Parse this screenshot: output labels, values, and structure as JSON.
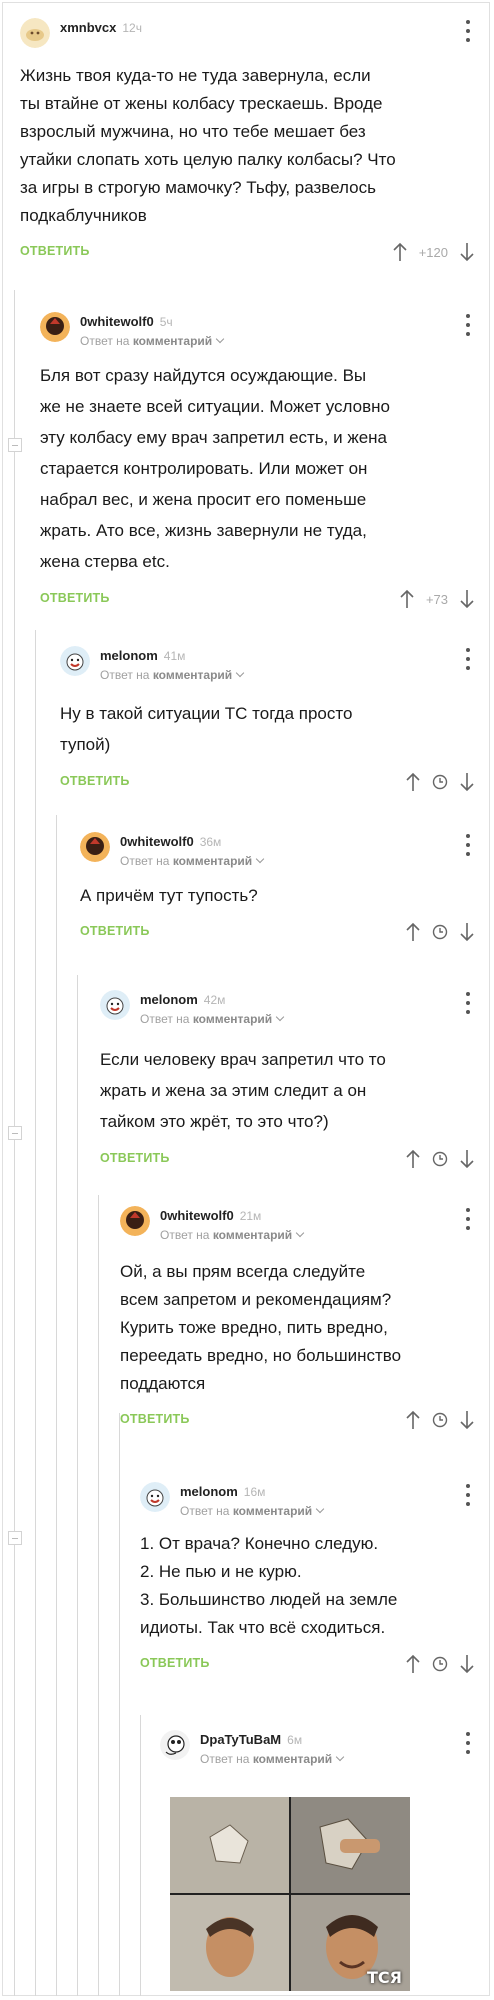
{
  "reply_label": "ОТВЕТИТЬ",
  "reply_to_prefix": "Ответ на",
  "reply_to_target": "комментарий",
  "comments": [
    {
      "user": "xmnbvcx",
      "time": "12ч",
      "text": [
        "Жизнь твоя куда-то не туда завернула, если",
        "ты втайне от жены колбасу трескаешь. Вроде",
        "взрослый мужчина, но что тебе мешает без",
        "утайки слопать хоть целую палку колбасы? Что",
        "за игры в строгую мамочку? Тьфу, развелось",
        "подкаблучников"
      ],
      "rating": "+120"
    },
    {
      "user": "0whitewolf0",
      "time": "5ч",
      "text": [
        "Бля вот сразу найдутся осуждающие. Вы",
        "же не знаете всей ситуации. Может условно",
        "эту колбасу ему врач запретил есть, и жена",
        "старается контролировать. Или может он",
        "набрал вес, и жена просит его поменьше",
        "жрать. Ато все, жизнь завернули не туда,",
        "жена стерва etc."
      ],
      "rating": "+73"
    },
    {
      "user": "melonom",
      "time": "41м",
      "text": [
        "Ну в такой ситуации ТС тогда просто",
        "тупой)"
      ]
    },
    {
      "user": "0whitewolf0",
      "time": "36м",
      "text": [
        "А причём тут тупость?"
      ]
    },
    {
      "user": "melonom",
      "time": "42м",
      "text": [
        "Если человеку врач запретил что то",
        "жрать и жена за этим следит а он",
        "тайком это жрёт, то это что?)"
      ]
    },
    {
      "user": "0whitewolf0",
      "time": "21м",
      "text": [
        "Ой, а вы прям всегда следуйте",
        "всем запретом и рекомендациям?",
        "Курить тоже вредно, пить вредно,",
        "переедать вредно, но большинство",
        "поддаются"
      ]
    },
    {
      "user": "melonom",
      "time": "16м",
      "text": [
        "1. От врача? Конечно следую.",
        "2. Не пью и не курю.",
        "3. Большинство людей на земле",
        "идиоты. Так что всё сходиться."
      ]
    },
    {
      "user": "DpaTyTuBaM",
      "time": "6м",
      "text": []
    }
  ],
  "meme_caption": "ТСЯ",
  "colors": {
    "accent": "#8ac858",
    "muted": "#a9a9a9",
    "text": "#1a1a1a"
  }
}
